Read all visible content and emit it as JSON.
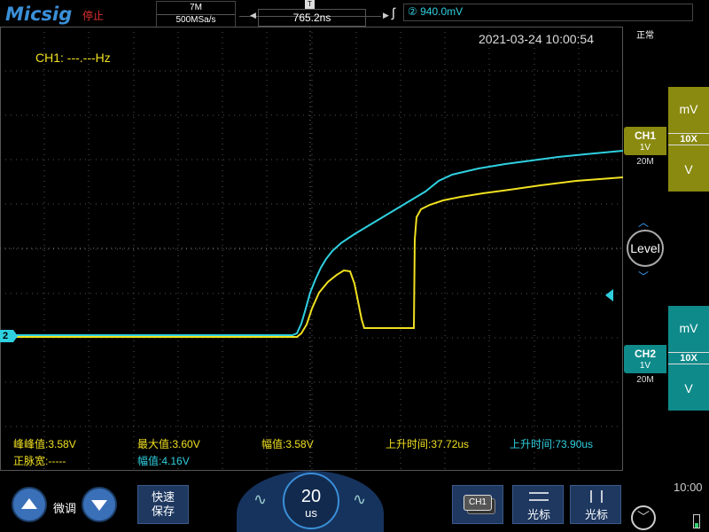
{
  "header": {
    "logo": "Micsig",
    "run_status": "停止",
    "memory_depth": "7M",
    "sample_rate": "500MSa/s",
    "horizontal_delay": "765.2ns",
    "trigger_source_marker": "②",
    "trigger_level": "940.0mV",
    "trigger_mode": "正常"
  },
  "screen": {
    "timestamp": "2021-03-24 10:00:54",
    "frequency_readout": "CH1: ---.---Hz"
  },
  "measurements": [
    {
      "label": "峰峰值:3.58V",
      "channel": "CH1"
    },
    {
      "label": "最大值:3.60V",
      "channel": "CH1"
    },
    {
      "label": "幅值:3.58V",
      "channel": "CH1"
    },
    {
      "label": "上升时间:37.72us",
      "channel": "CH1"
    },
    {
      "label": "上升时间:73.90us",
      "channel": "CH2"
    },
    {
      "label": "正脉宽:-----",
      "channel": "CH1"
    },
    {
      "label": "幅值:4.16V",
      "channel": "CH2"
    }
  ],
  "channels": {
    "ch1": {
      "name": "CH1",
      "volts_per_div": "1V",
      "bandwidth": "20M",
      "scale_unit_top": "mV",
      "probe": "10X",
      "scale_unit_bottom": "V",
      "color": "#f0e020"
    },
    "ch2": {
      "name": "CH2",
      "volts_per_div": "1V",
      "bandwidth": "20M",
      "scale_unit_top": "mV",
      "probe": "10X",
      "scale_unit_bottom": "V",
      "color": "#2fd0e0",
      "ground_marker": "2"
    }
  },
  "level_knob": {
    "label": "Level"
  },
  "bottom": {
    "fine_adjust": "微调",
    "quick_save_line1": "快速",
    "quick_save_line2": "保存",
    "timebase_value": "20",
    "timebase_unit": "us",
    "ch1_button": "CH1",
    "cursor_h": "光标",
    "cursor_v": "光标",
    "clock": "10:00"
  },
  "icons": [
    "up-arrow-icon",
    "down-arrow-icon",
    "wave-icon",
    "trigger-edge-icon",
    "menu-down-icon",
    "battery-icon"
  ]
}
